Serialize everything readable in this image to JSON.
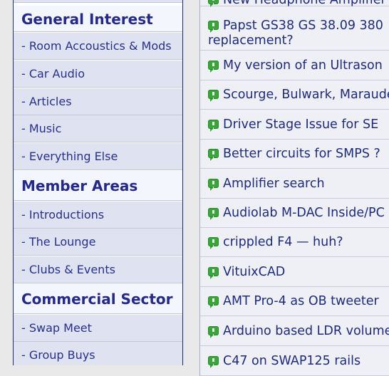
{
  "sidebar": {
    "sections": [
      {
        "heading": "General Interest",
        "links": [
          "- Room Accoustics & Mods",
          "- Car Audio",
          "- Articles",
          "- Music",
          "- Everything Else"
        ]
      },
      {
        "heading": "Member Areas",
        "links": [
          "- Introductions",
          "- The Lounge",
          "- Clubs & Events"
        ]
      },
      {
        "heading": "Commercial Sector",
        "links": [
          "- Swap Meet",
          "- Group Buys"
        ]
      }
    ]
  },
  "threads": {
    "items": [
      {
        "title": "New Headphone Amplifier"
      },
      {
        "title": "Papst GS38 GS 38.09 380",
        "title_line2": "replacement?"
      },
      {
        "title": "My version of an Ultrason"
      },
      {
        "title": "Scourge, Bulwark, Marauder"
      },
      {
        "title": "Driver Stage Issue for SE"
      },
      {
        "title": "Better circuits for SMPS ?"
      },
      {
        "title": "Amplifier search"
      },
      {
        "title": "Audiolab M-DAC Inside/PC"
      },
      {
        "title": "crippled F4 — huh?"
      },
      {
        "title": "VituixCAD"
      },
      {
        "title": "AMT Pro-4 as OB tweeter"
      },
      {
        "title": "Arduino based LDR volume"
      },
      {
        "title": "C47 on SWAP125 rails"
      }
    ]
  },
  "colors": {
    "sidebar_border": "#1d2a6e",
    "heading_text": "#25298a",
    "link_bg": "#dfe3f1",
    "thread_text": "#1f2b7a",
    "bubble_green": "#3aa53a"
  }
}
